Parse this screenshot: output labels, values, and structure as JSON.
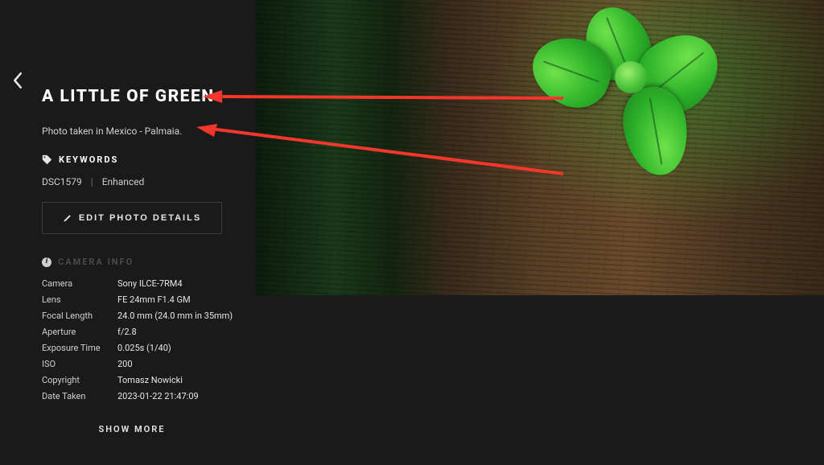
{
  "title": "A LITTLE OF GREEN",
  "caption": "Photo taken in Mexico - Palmaia.",
  "keywords_header": "KEYWORDS",
  "keywords": [
    "DSC1579",
    "Enhanced"
  ],
  "edit_button_label": "EDIT PHOTO DETAILS",
  "camera_info_header": "CAMERA INFO",
  "camera_meta": {
    "Camera": "Sony ILCE-7RM4",
    "Lens": "FE 24mm F1.4 GM",
    "Focal Length": "24.0 mm (24.0 mm in 35mm)",
    "Aperture": "f/2.8",
    "Exposure Time": "0.025s (1/40)",
    "ISO": "200",
    "Copyright": "Tomasz Nowicki",
    "Date Taken": "2023-01-22 21:47:09"
  },
  "show_more_label": "SHOW MORE",
  "annotation": {
    "color": "#f4372a",
    "arrows": [
      {
        "from": "photo-area",
        "to": "title"
      },
      {
        "from": "photo-area",
        "to": "caption"
      }
    ]
  }
}
